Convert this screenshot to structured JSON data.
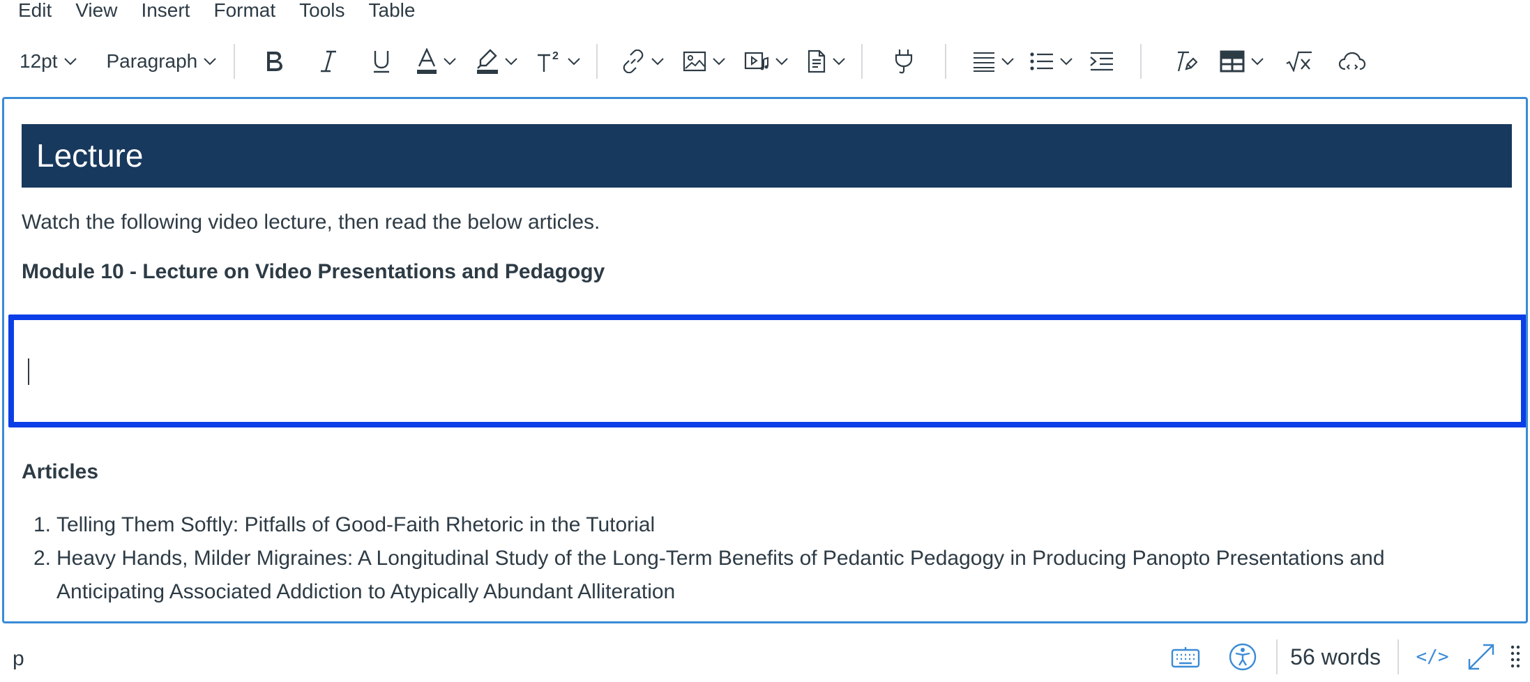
{
  "menubar": {
    "items": [
      "Edit",
      "View",
      "Insert",
      "Format",
      "Tools",
      "Table"
    ]
  },
  "toolbar": {
    "font_size": "12pt",
    "block_format": "Paragraph"
  },
  "document": {
    "banner_title": "Lecture",
    "intro": "Watch the following video lecture, then read the below articles.",
    "module_title": "Module 10 - Lecture on Video Presentations and Pedagogy",
    "articles_heading": "Articles",
    "articles": [
      {
        "num": "1.",
        "line1": "Telling Them Softly: Pitfalls of Good-Faith Rhetoric in the Tutorial",
        "line2": ""
      },
      {
        "num": "2.",
        "line1": "Heavy Hands, Milder Migraines: A Longitudinal Study of the Long-Term Benefits of Pedantic Pedagogy in Producing Panopto Presentations and",
        "line2": "Anticipating Associated Addiction to Atypically Abundant Alliteration"
      }
    ]
  },
  "statusbar": {
    "path": "p",
    "word_count": "56 words",
    "html_toggle": "</>"
  },
  "colors": {
    "banner_bg": "#18395e",
    "focus_border": "#0b3ee6",
    "editor_border": "#3a8bd6",
    "icon_blue": "#3a8bd6",
    "text": "#2d3b45"
  }
}
